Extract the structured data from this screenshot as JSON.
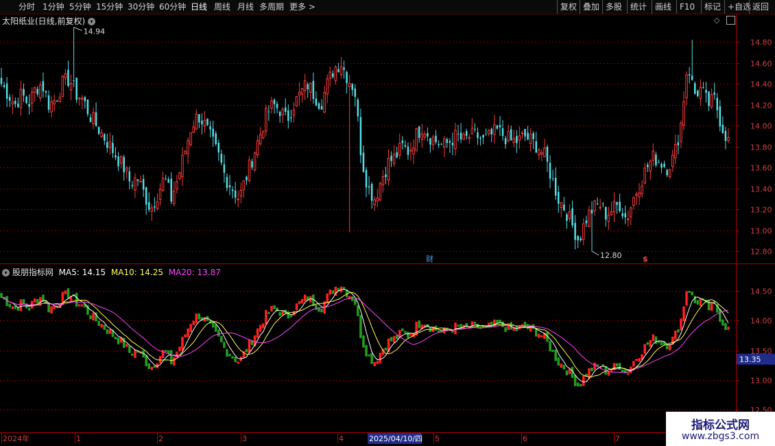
{
  "toolbar": {
    "timeframes": [
      "分时",
      "1分钟",
      "5分钟",
      "15分钟",
      "30分钟",
      "60分钟",
      "日线",
      "周线",
      "月线",
      "多周期",
      "更多 >"
    ],
    "active": "日线",
    "right_buttons": [
      "复权",
      "叠加",
      "多股",
      "统计",
      "画线",
      "F10",
      "标记",
      "+自选",
      "返回"
    ]
  },
  "main_chart": {
    "title": "太阳纸业(日线,前复权)",
    "high_label": "14.94",
    "low_label": "12.80",
    "fin_marker": "财",
    "s_marker": "$",
    "y_ticks": [
      "14.80",
      "14.60",
      "14.40",
      "14.20",
      "14.00",
      "13.80",
      "13.60",
      "13.40",
      "13.20",
      "13.00",
      "12.80"
    ]
  },
  "indicator": {
    "name": "股朋指标网",
    "ma5": "MA5: 14.15",
    "ma10": "MA10: 14.25",
    "ma20": "MA20: 13.87",
    "y_ticks": [
      "14.50",
      "14.00",
      "13.50",
      "13.00",
      "12.50"
    ],
    "current_price": "13.35"
  },
  "axis": {
    "labels": [
      "2024年",
      "1",
      "2",
      "3",
      "4",
      "5",
      "6",
      "7"
    ],
    "cursor_date": "2025/04/10/四"
  },
  "watermark": {
    "line1": "指标公式网",
    "line2": "www.zbgs3.com"
  },
  "colors": {
    "up": "#ff3b3b",
    "down": "#54e0e8",
    "ind_up": "#ff2020",
    "ind_down": "#20a020",
    "ma5": "#ffffff",
    "ma10": "#ffff55",
    "ma20": "#ff44ff",
    "grid": "#800000"
  },
  "chart_data": {
    "type": "candlestick",
    "y_range": [
      12.8,
      14.94
    ],
    "close_path": [
      14.4,
      14.3,
      14.2,
      14.3,
      14.2,
      14.35,
      14.4,
      14.2,
      14.25,
      14.4,
      14.45,
      14.3,
      14.25,
      14.1,
      14.0,
      13.9,
      13.8,
      13.7,
      13.6,
      13.45,
      13.5,
      13.35,
      13.2,
      13.35,
      13.5,
      13.3,
      13.5,
      13.75,
      14.0,
      14.1,
      14.0,
      13.85,
      13.7,
      13.5,
      13.4,
      13.3,
      13.5,
      13.7,
      13.9,
      14.1,
      14.2,
      14.15,
      14.05,
      14.2,
      14.3,
      14.4,
      14.3,
      14.2,
      14.4,
      14.55,
      14.6,
      14.45,
      14.35,
      13.7,
      13.4,
      13.3,
      13.5,
      13.65,
      13.7,
      13.8,
      13.75,
      13.9,
      14.0,
      13.9,
      13.85,
      13.8,
      13.85,
      13.9,
      13.85,
      13.9,
      13.9,
      13.85,
      13.9,
      13.95,
      13.9,
      13.85,
      13.85,
      13.9,
      13.85,
      13.8,
      13.7,
      13.5,
      13.3,
      13.2,
      13.05,
      12.9,
      13.1,
      13.2,
      13.25,
      13.15,
      13.2,
      13.25,
      13.1,
      13.3,
      13.45,
      13.6,
      13.7,
      13.65,
      13.6,
      13.7,
      14.0,
      14.6,
      14.3,
      14.35,
      14.2,
      14.25,
      14.0,
      13.85
    ]
  }
}
